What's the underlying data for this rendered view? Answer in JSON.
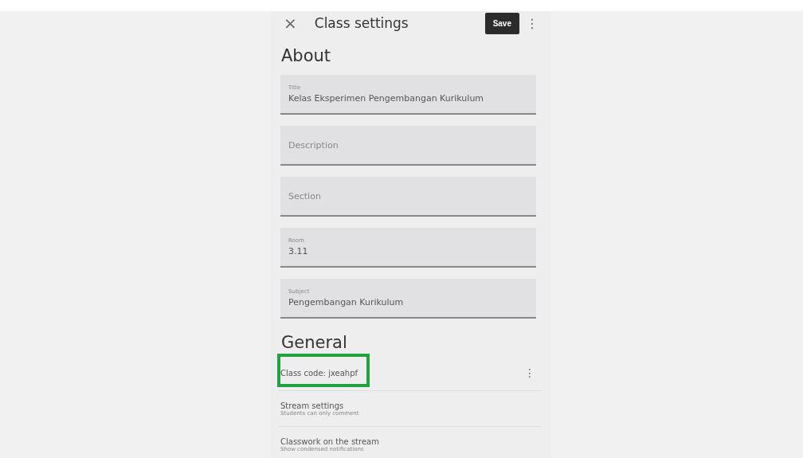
{
  "header": {
    "close": "×",
    "title": "Class settings",
    "save": "Save",
    "more": "⋮"
  },
  "about": {
    "heading": "About",
    "fields": [
      {
        "label": "Title",
        "value": "Kelas Eksperimen Pengembangan Kurikulum"
      },
      {
        "placeholder": "Description"
      },
      {
        "placeholder": "Section"
      },
      {
        "label": "Room",
        "value": "3.11"
      },
      {
        "label": "Subject",
        "value": "Pengembangan Kurikulum"
      }
    ]
  },
  "general": {
    "heading": "General",
    "items": [
      {
        "title": "Class code: jxeahpf",
        "more": "⋮",
        "highlighted": true
      },
      {
        "title": "Stream settings",
        "subtitle": "Students can only comment",
        "highlighted": false
      },
      {
        "title": "Classwork on the stream",
        "subtitle": "Show condensed notifications",
        "highlighted": false
      }
    ]
  }
}
